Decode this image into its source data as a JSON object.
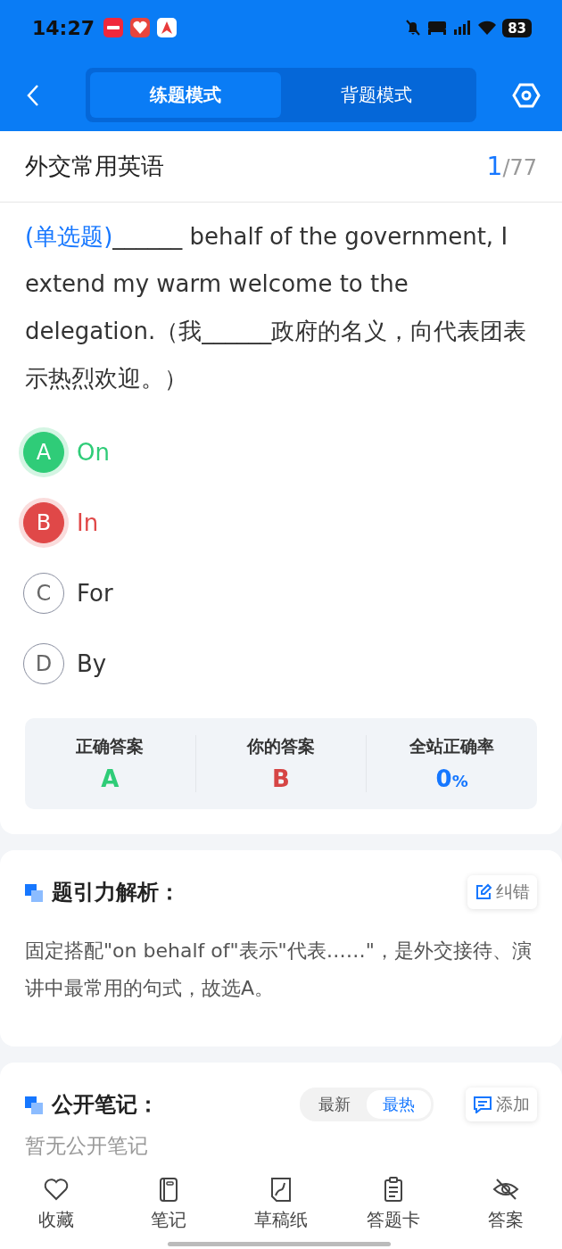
{
  "status_bar": {
    "time": "14:27",
    "battery": "83"
  },
  "header": {
    "tabs": [
      {
        "label": "练题模式",
        "selected": true
      },
      {
        "label": "背题模式",
        "selected": false
      }
    ]
  },
  "title_row": {
    "title": "外交常用英语",
    "current": "1",
    "total": "/77"
  },
  "question": {
    "type_label": "(单选题)",
    "text": "______ behalf of the government, I extend my warm welcome to the delegation.（我______政府的名义，向代表团表示热烈欢迎。）"
  },
  "options": [
    {
      "letter": "A",
      "text": "On",
      "kind": "correct"
    },
    {
      "letter": "B",
      "text": "In",
      "kind": "wrong"
    },
    {
      "letter": "C",
      "text": "For",
      "kind": "plain"
    },
    {
      "letter": "D",
      "text": "By",
      "kind": "plain"
    }
  ],
  "result": [
    {
      "label": "正确答案",
      "value": "A",
      "kind": "correct"
    },
    {
      "label": "你的答案",
      "value": "B",
      "kind": "wrong"
    },
    {
      "label": "全站正确率",
      "value": "0",
      "unit": "%",
      "kind": "rate"
    }
  ],
  "analysis": {
    "title": "题引力解析：",
    "button": "纠错",
    "text": "固定搭配\"on behalf of\"表示\"代表……\"，是外交接待、演讲中最常用的句式，故选A。"
  },
  "notes": {
    "title": "公开笔记：",
    "sort": [
      {
        "label": "最新",
        "selected": false
      },
      {
        "label": "最热",
        "selected": true
      }
    ],
    "button": "添加",
    "empty": "暂无公开笔记"
  },
  "bottom_nav": [
    {
      "label": "收藏",
      "kind": "heart"
    },
    {
      "label": "笔记",
      "kind": "notebook"
    },
    {
      "label": "草稿纸",
      "kind": "draft"
    },
    {
      "label": "答题卡",
      "kind": "clipboard"
    },
    {
      "label": "答案",
      "kind": "eyeoff"
    }
  ]
}
